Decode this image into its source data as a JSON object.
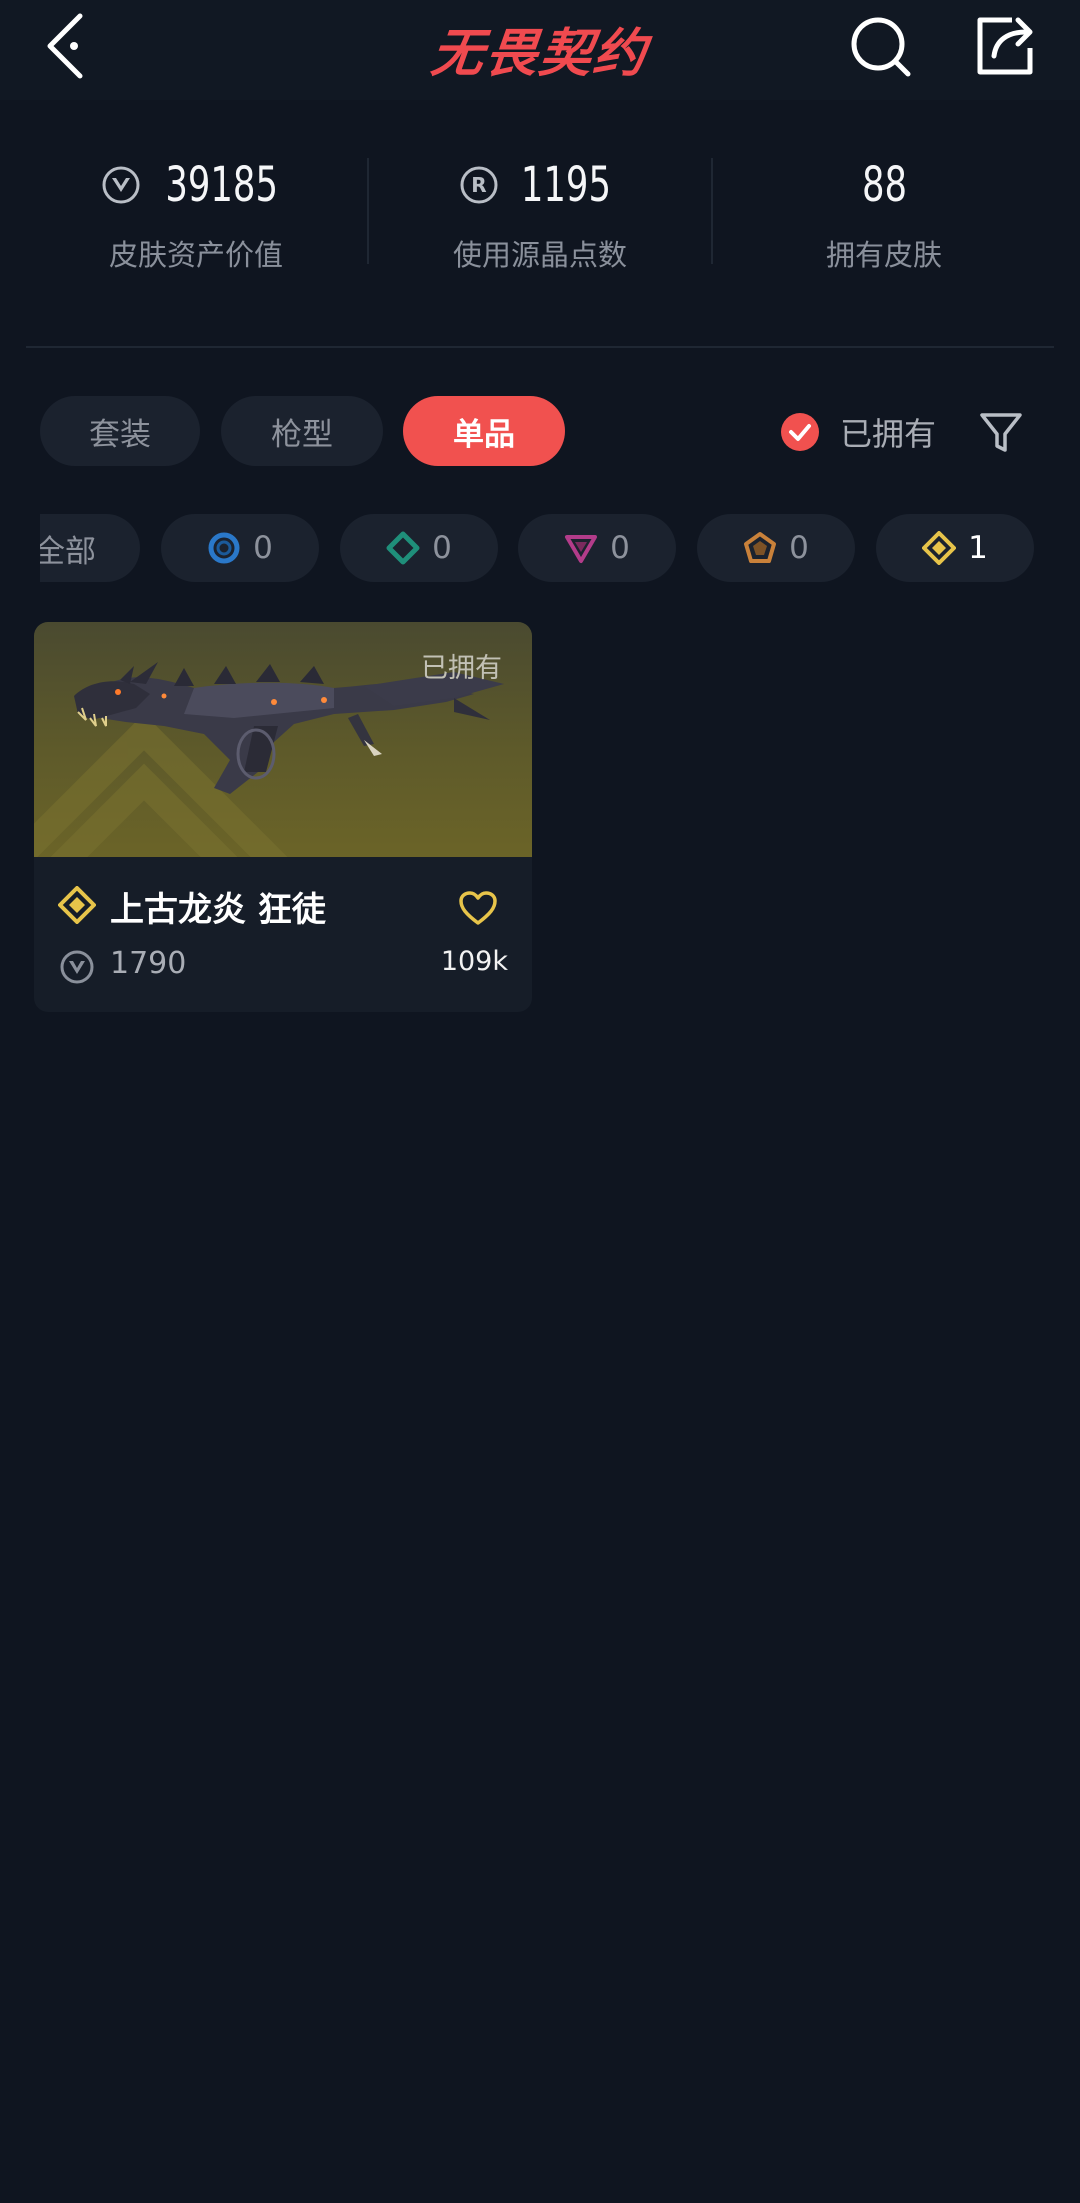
{
  "header": {
    "logo_text": "无畏契约",
    "back_icon": "chevron-left-icon",
    "search_icon": "search-icon",
    "share_icon": "share-icon"
  },
  "stats": [
    {
      "icon": "valorant-points-icon",
      "value": "39185",
      "label": "皮肤资产价值"
    },
    {
      "icon": "radianite-icon",
      "value": "1195",
      "label": "使用源晶点数"
    },
    {
      "icon": "",
      "value": "88",
      "label": "拥有皮肤"
    }
  ],
  "tabs": [
    {
      "label": "套装",
      "active": false
    },
    {
      "label": "枪型",
      "active": false
    },
    {
      "label": "单品",
      "active": true
    }
  ],
  "owned_filter": {
    "label": "已拥有",
    "checked": true
  },
  "rarity_chips": [
    {
      "label": "全部",
      "icon": "",
      "count": ""
    },
    {
      "icon": "select-tier-icon",
      "color": "#2a78c9",
      "count": "0"
    },
    {
      "icon": "deluxe-tier-icon",
      "color": "#1f8f7a",
      "count": "0"
    },
    {
      "icon": "premium-tier-icon",
      "color": "#b33c8a",
      "count": "0"
    },
    {
      "icon": "ultra-tier-icon",
      "color": "#c9813a",
      "count": "0"
    },
    {
      "icon": "exclusive-tier-icon",
      "color": "#e7c44a",
      "count": "1"
    }
  ],
  "cards": [
    {
      "owned_tag": "已拥有",
      "name": "上古龙炎 狂徒",
      "tier_icon": "exclusive-tier-icon",
      "price": "1790",
      "likes": "109k"
    }
  ],
  "colors": {
    "background": "#0f1520",
    "accent": "#f1514f",
    "exclusive": "#e7c44a"
  }
}
